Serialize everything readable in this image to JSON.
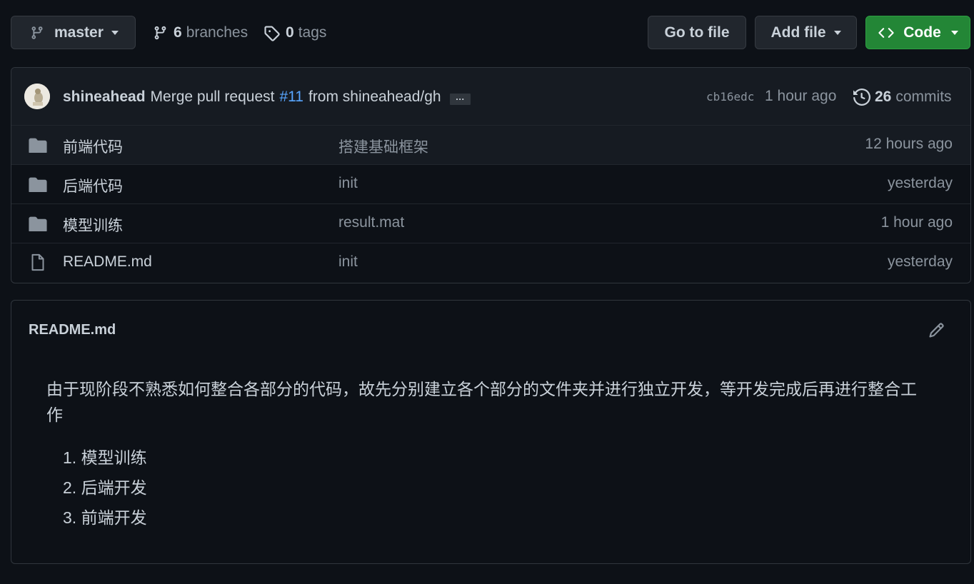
{
  "toolbar": {
    "branch": "master",
    "branches_count": "6",
    "branches_label": "branches",
    "tags_count": "0",
    "tags_label": "tags",
    "go_to_file": "Go to file",
    "add_file": "Add file",
    "code": "Code"
  },
  "commit": {
    "author": "shineahead",
    "message_prefix": "Merge pull request",
    "pr": "#11",
    "message_suffix": "from shineahead/gh",
    "ellipsis": "…",
    "sha": "cb16edc",
    "time": "1 hour ago",
    "commits_count": "26",
    "commits_label": "commits"
  },
  "files": [
    {
      "name": "前端代码",
      "type": "folder",
      "message": "搭建基础框架",
      "time": "12 hours ago"
    },
    {
      "name": "后端代码",
      "type": "folder",
      "message": "init",
      "time": "yesterday"
    },
    {
      "name": "模型训练",
      "type": "folder",
      "message": "result.mat",
      "time": "1 hour ago"
    },
    {
      "name": "README.md",
      "type": "file",
      "message": "init",
      "time": "yesterday"
    }
  ],
  "readme": {
    "title": "README.md",
    "paragraph": "由于现阶段不熟悉如何整合各部分的代码，故先分别建立各个部分的文件夹并进行独立开发，等开发完成后再进行整合工作",
    "list": [
      "1. 模型训练",
      "2. 后端开发",
      "3. 前端开发"
    ]
  },
  "colors": {
    "background": "#0d1117",
    "header_row": "#161b22",
    "border": "#30363d",
    "code_button": "#238636",
    "link": "#58a6ff",
    "muted_text": "#8b949e",
    "folder_icon": "#8b949e"
  },
  "icons": {
    "branch": "git-branch-icon",
    "tag": "tag-icon",
    "code": "code-icon",
    "history": "history-icon",
    "folder": "folder-icon",
    "file": "file-icon",
    "edit": "pencil-icon"
  }
}
